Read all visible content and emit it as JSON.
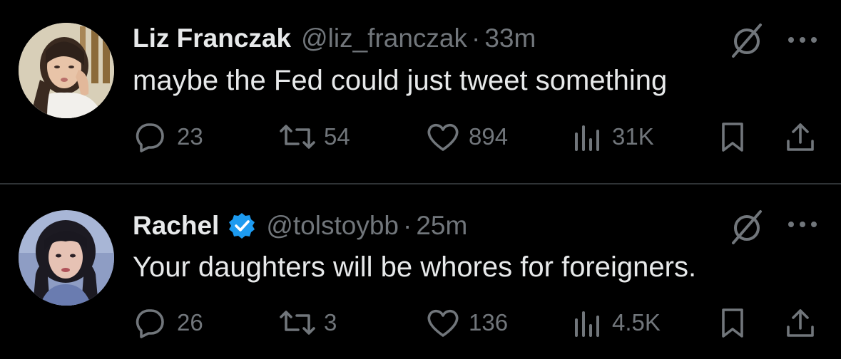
{
  "colors": {
    "background": "#000000",
    "text": "#e7e9ea",
    "muted": "#71767b",
    "divider": "#2f3336",
    "verified": "#1d9bf0"
  },
  "tweets": [
    {
      "name": "Liz Franczak",
      "handle": "@liz_franczak",
      "dot": "·",
      "time": "33m",
      "verified": false,
      "text": "maybe the Fed could just tweet something",
      "replies": "23",
      "reposts": "54",
      "likes": "894",
      "views": "31K"
    },
    {
      "name": "Rachel",
      "handle": "@tolstoybb",
      "dot": "·",
      "time": "25m",
      "verified": true,
      "text": "Your daughters will be whores for foreigners.",
      "replies": "26",
      "reposts": "3",
      "likes": "136",
      "views": "4.5K"
    }
  ],
  "icons": [
    "grok-icon",
    "more-icon",
    "reply-icon",
    "repost-icon",
    "like-icon",
    "views-icon",
    "bookmark-icon",
    "share-icon",
    "verified-badge-icon"
  ]
}
